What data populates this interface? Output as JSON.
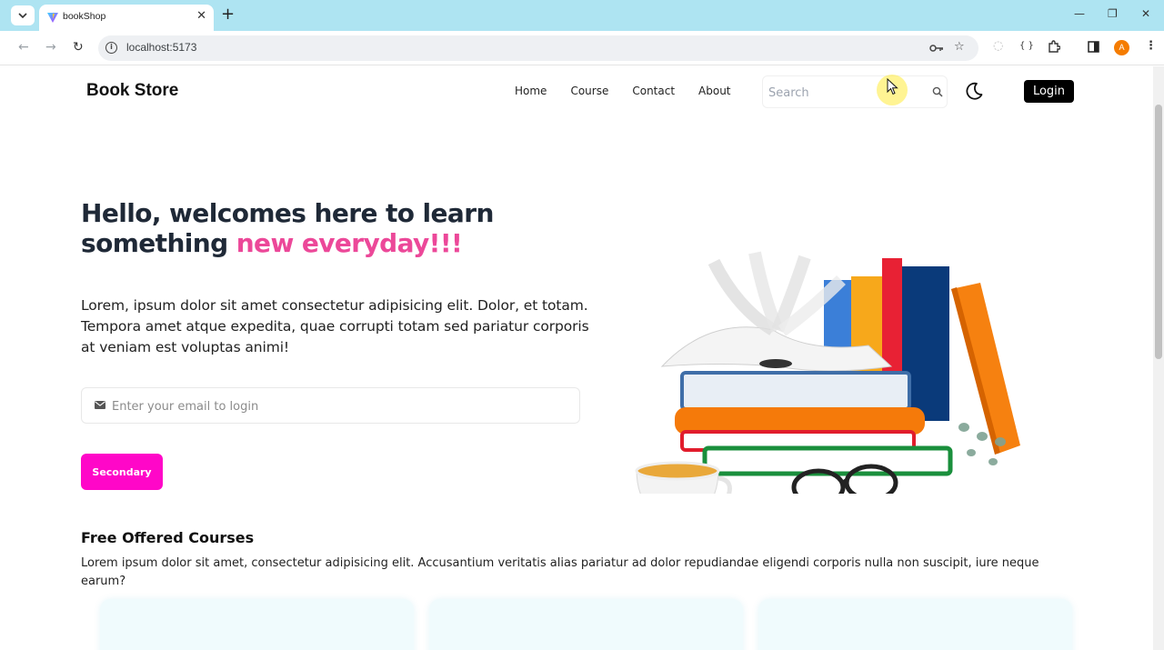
{
  "browser": {
    "tab_title": "bookShop",
    "url": "localhost:5173",
    "profile_initial": "A"
  },
  "navbar": {
    "brand": "Book Store",
    "menu": [
      "Home",
      "Course",
      "Contact",
      "About"
    ],
    "search_placeholder": "Search",
    "login_label": "Login"
  },
  "hero": {
    "title_line1": "Hello, welcomes here to learn",
    "title_line2_prefix": "something ",
    "title_accent": "new everyday!!!",
    "accent_color": "#ec4899",
    "paragraph": "Lorem, ipsum dolor sit amet consectetur adipisicing elit. Dolor, et totam. Tempora amet atque expedita, quae corrupti totam sed pariatur corporis at veniam est voluptas animi!",
    "email_placeholder": "Enter your email to login",
    "cta_label": "Secondary",
    "cta_color": "#ff07c8"
  },
  "courses": {
    "title": "Free Offered Courses",
    "description": "Lorem ipsum dolor sit amet, consectetur adipisicing elit. Accusantium veritatis alias pariatur ad dolor repudiandae eligendi corporis nulla non suscipit, iure neque earum?"
  }
}
